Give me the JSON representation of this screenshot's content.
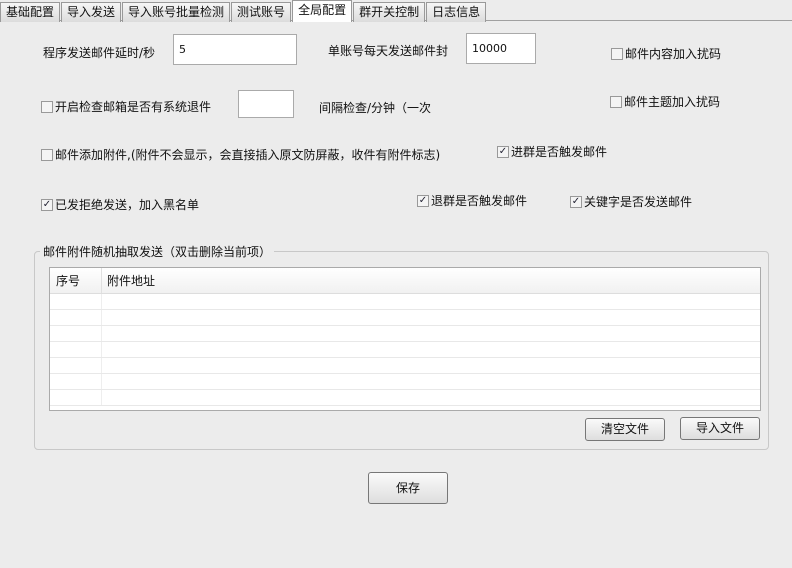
{
  "tabs": [
    "基础配置",
    "导入发送",
    "导入账号批量检测",
    "测试账号",
    "全局配置",
    "群开关控制",
    "日志信息"
  ],
  "active_tab": 4,
  "fields": {
    "delay_label": "程序发送邮件延时/秒",
    "delay_value": "5",
    "daily_label": "单账号每天发送邮件封",
    "daily_value": "10000",
    "interval_label": "间隔检查/分钟（一次",
    "interval_value": ""
  },
  "checkboxes": {
    "content_noise": {
      "label": "邮件内容加入扰码",
      "checked": false
    },
    "subject_noise": {
      "label": "邮件主题加入扰码",
      "checked": false
    },
    "check_bounce": {
      "label": "开启检查邮箱是否有系统退件",
      "checked": false
    },
    "add_attachment": {
      "label": "邮件添加附件,(附件不会显示，会直接插入原文防屏蔽，收件有附件标志)",
      "checked": false
    },
    "join_trigger": {
      "label": "进群是否触发邮件",
      "checked": true
    },
    "reject_blacklist": {
      "label": "已发拒绝发送，加入黑名单",
      "checked": true
    },
    "leave_trigger": {
      "label": "退群是否触发邮件",
      "checked": true
    },
    "keyword_send": {
      "label": "关键字是否发送邮件",
      "checked": true
    }
  },
  "attachments": {
    "title": "邮件附件随机抽取发送（双击删除当前项）",
    "columns": [
      "序号",
      "附件地址"
    ],
    "rows": []
  },
  "buttons": {
    "clear": "清空文件",
    "import": "导入文件",
    "save": "保存"
  }
}
